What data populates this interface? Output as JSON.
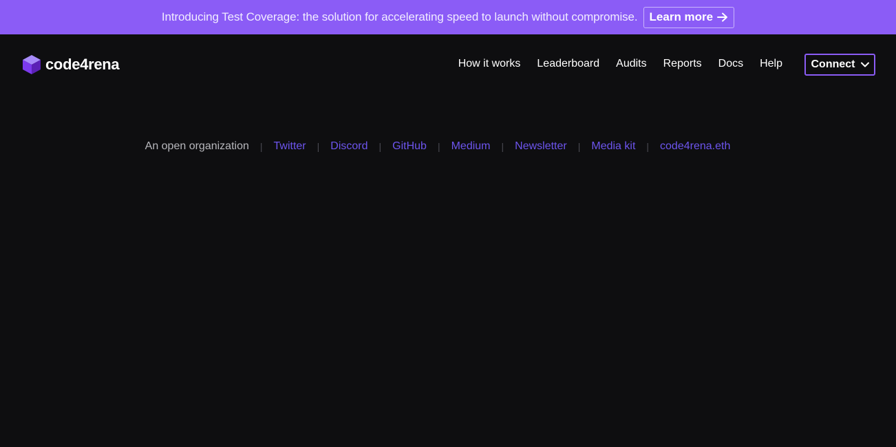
{
  "banner": {
    "text": "Introducing Test Coverage: the solution for accelerating speed to launch without compromise.",
    "button_label": "Learn more",
    "button_icon": "arrow-right-icon",
    "background": "#8b5cf6"
  },
  "header": {
    "logo_text": "code4rena",
    "logo_icon": "cube-logo-icon",
    "nav": [
      {
        "label": "How it works"
      },
      {
        "label": "Leaderboard"
      },
      {
        "label": "Audits"
      },
      {
        "label": "Reports"
      },
      {
        "label": "Docs"
      },
      {
        "label": "Help"
      }
    ],
    "connect_label": "Connect",
    "connect_icon": "chevron-down-icon",
    "accent": "#8b5cf6"
  },
  "footer": {
    "label": "An open organization",
    "separator": "|",
    "links": [
      {
        "label": "Twitter"
      },
      {
        "label": "Discord"
      },
      {
        "label": "GitHub"
      },
      {
        "label": "Medium"
      },
      {
        "label": "Newsletter"
      },
      {
        "label": "Media kit"
      },
      {
        "label": "code4rena.eth"
      }
    ],
    "link_color": "#6d55ee"
  },
  "page": {
    "background": "#0e0e10"
  }
}
